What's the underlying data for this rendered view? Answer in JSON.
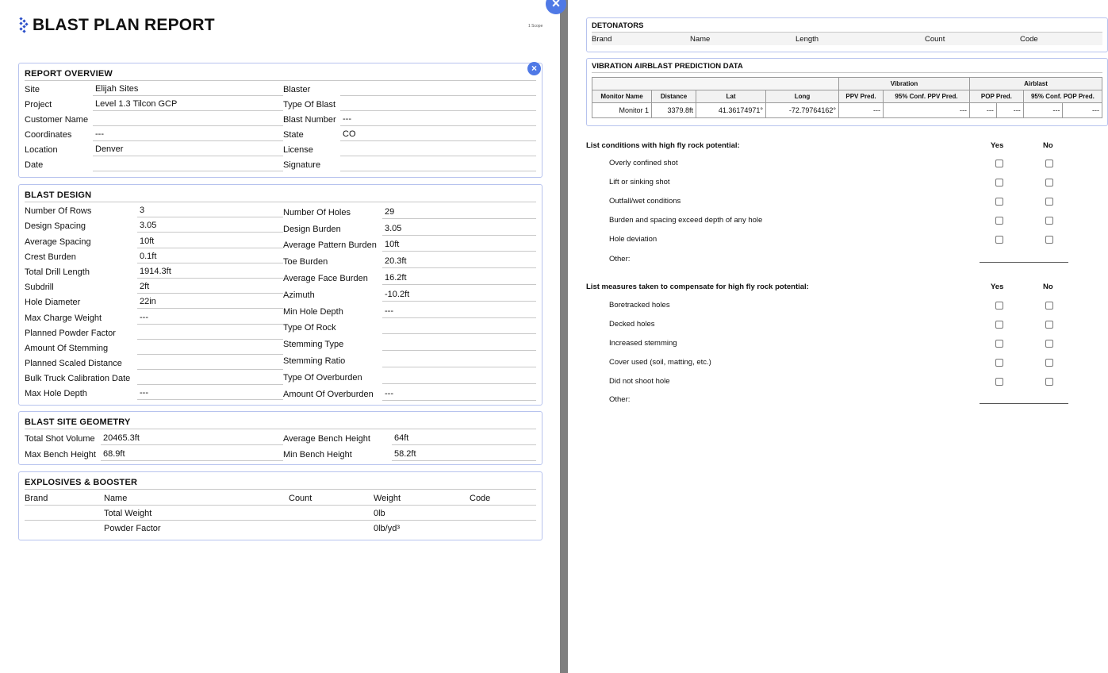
{
  "report": {
    "title": "BLAST PLAN REPORT",
    "page_meta": "1 Scope"
  },
  "overview": {
    "title": "REPORT OVERVIEW",
    "left": [
      {
        "label": "Site",
        "value": "Elijah Sites"
      },
      {
        "label": "Project",
        "value": "Level 1.3 Tilcon GCP"
      },
      {
        "label": "Customer Name",
        "value": ""
      },
      {
        "label": "Coordinates",
        "value": "---"
      },
      {
        "label": "Location",
        "value": "Denver"
      },
      {
        "label": "Date",
        "value": ""
      }
    ],
    "right": [
      {
        "label": "Blaster",
        "value": ""
      },
      {
        "label": "Type Of Blast",
        "value": ""
      },
      {
        "label": "Blast Number",
        "value": "---"
      },
      {
        "label": "State",
        "value": "CO"
      },
      {
        "label": "License",
        "value": ""
      },
      {
        "label": "Signature",
        "value": ""
      }
    ]
  },
  "design": {
    "title": "BLAST DESIGN",
    "left": [
      {
        "label": "Number Of Rows",
        "value": "3"
      },
      {
        "label": "Design Spacing",
        "value": "3.05"
      },
      {
        "label": "Average Spacing",
        "value": "10ft"
      },
      {
        "label": "Crest Burden",
        "value": "0.1ft"
      },
      {
        "label": "Total Drill Length",
        "value": "1914.3ft"
      },
      {
        "label": "Subdrill",
        "value": "2ft"
      },
      {
        "label": "Hole Diameter",
        "value": "22in"
      },
      {
        "label": "Max Charge Weight",
        "value": "---"
      },
      {
        "label": "Planned Powder Factor",
        "value": ""
      },
      {
        "label": "Amount Of Stemming",
        "value": ""
      },
      {
        "label": "Planned Scaled Distance",
        "value": ""
      },
      {
        "label": "Bulk Truck Calibration Date",
        "value": ""
      },
      {
        "label": "Max Hole Depth",
        "value": "---"
      }
    ],
    "right": [
      {
        "label": "Number Of Holes",
        "value": "29"
      },
      {
        "label": "Design Burden",
        "value": "3.05"
      },
      {
        "label": "Average Pattern Burden",
        "value": "10ft"
      },
      {
        "label": "Toe Burden",
        "value": "20.3ft"
      },
      {
        "label": "Average Face Burden",
        "value": "16.2ft"
      },
      {
        "label": "Azimuth",
        "value": "-10.2ft"
      },
      {
        "label": "Min Hole Depth",
        "value": "---"
      },
      {
        "label": "Type Of Rock",
        "value": ""
      },
      {
        "label": "Stemming Type",
        "value": ""
      },
      {
        "label": "Stemming Ratio",
        "value": ""
      },
      {
        "label": "Type Of Overburden",
        "value": ""
      },
      {
        "label": "Amount Of Overburden",
        "value": "---"
      }
    ]
  },
  "geometry": {
    "title": "BLAST SITE GEOMETRY",
    "left": [
      {
        "label": "Total Shot Volume",
        "value": "20465.3ft"
      },
      {
        "label": "Max Bench Height",
        "value": "68.9ft"
      }
    ],
    "right": [
      {
        "label": "Average Bench Height",
        "value": "64ft"
      },
      {
        "label": "Min Bench Height",
        "value": "58.2ft"
      }
    ]
  },
  "explosives": {
    "title": "EXPLOSIVES & BOOSTER",
    "headers": [
      "Brand",
      "Name",
      "Count",
      "Weight",
      "Code"
    ],
    "total_weight_label": "Total Weight",
    "total_weight_value": "0lb",
    "powder_factor_label": "Powder Factor",
    "powder_factor_value": "0lb/yd³"
  },
  "detonators": {
    "title": "DETONATORS",
    "headers": [
      "Brand",
      "Name",
      "Length",
      "Count",
      "Code"
    ]
  },
  "vibration": {
    "title": "VIBRATION AIRBLAST PREDICTION DATA",
    "group_vibration": "Vibration",
    "group_airblast": "Airblast",
    "headers": [
      "Monitor Name",
      "Distance",
      "Lat",
      "Long",
      "PPV Pred.",
      "95% Conf. PPV Pred.",
      "POP Pred.",
      "95% Conf. POP Pred."
    ],
    "row": [
      "Monitor 1",
      "3379.8ft",
      "41.36174971°",
      "-72.79764162°",
      "---",
      "---",
      "---",
      "---",
      "---",
      "---"
    ]
  },
  "flyrock_conditions": {
    "title": "List conditions with high fly rock potential:",
    "yes": "Yes",
    "no": "No",
    "items": [
      "Overly confined shot",
      "Lift or sinking shot",
      "Outfall/wet conditions",
      "Burden and spacing exceed depth of any hole",
      "Hole deviation"
    ],
    "other": "Other:"
  },
  "flyrock_measures": {
    "title": "List measures taken to compensate for high fly rock potential:",
    "yes": "Yes",
    "no": "No",
    "items": [
      "Boretracked holes",
      "Decked holes",
      "Increased stemming",
      "Cover used (soil, matting, etc.)",
      "Did not shoot hole"
    ],
    "other": "Other:"
  },
  "colors": {
    "accent": "#4f79e6",
    "panel_border": "#b7c3ee",
    "divider": "#7f7f7f"
  }
}
